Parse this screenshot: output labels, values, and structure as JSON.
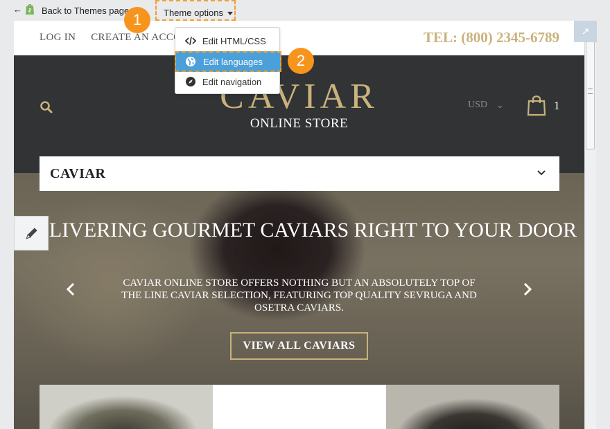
{
  "editor_bar": {
    "back_label": "Back to Themes page",
    "theme_options_label": "Theme options",
    "step1": "1",
    "step2": "2"
  },
  "dropdown": {
    "items": [
      {
        "label": "Edit HTML/CSS",
        "icon": "code-icon"
      },
      {
        "label": "Edit languages",
        "icon": "globe-icon"
      },
      {
        "label": "Edit navigation",
        "icon": "compass-icon"
      }
    ]
  },
  "store": {
    "top_links": [
      "LOG IN",
      "CREATE AN ACCOUNT"
    ],
    "phone": "TEL: (800) 2345-6789",
    "logo_main": "CAVIAR",
    "logo_sub": "ONLINE STORE",
    "currency": "USD",
    "cart_count": "1",
    "nav_title": "CAVIAR",
    "hero_title": "DELIVERING GOURMET CAVIARS RIGHT TO YOUR DOOR",
    "hero_text": "CAVIAR ONLINE STORE OFFERS NOTHING BUT AN ABSOLUTELY TOP OF THE LINE CAVIAR SELECTION, FEATURING TOP QUALITY SEVRUGA AND OSETRA CAVIARS.",
    "hero_button": "VIEW ALL CAVIARS"
  },
  "colors": {
    "gold": "#c9b27c",
    "dark_header": "#313335",
    "highlight": "#4ba0d9",
    "annotation": "#f7941d"
  }
}
